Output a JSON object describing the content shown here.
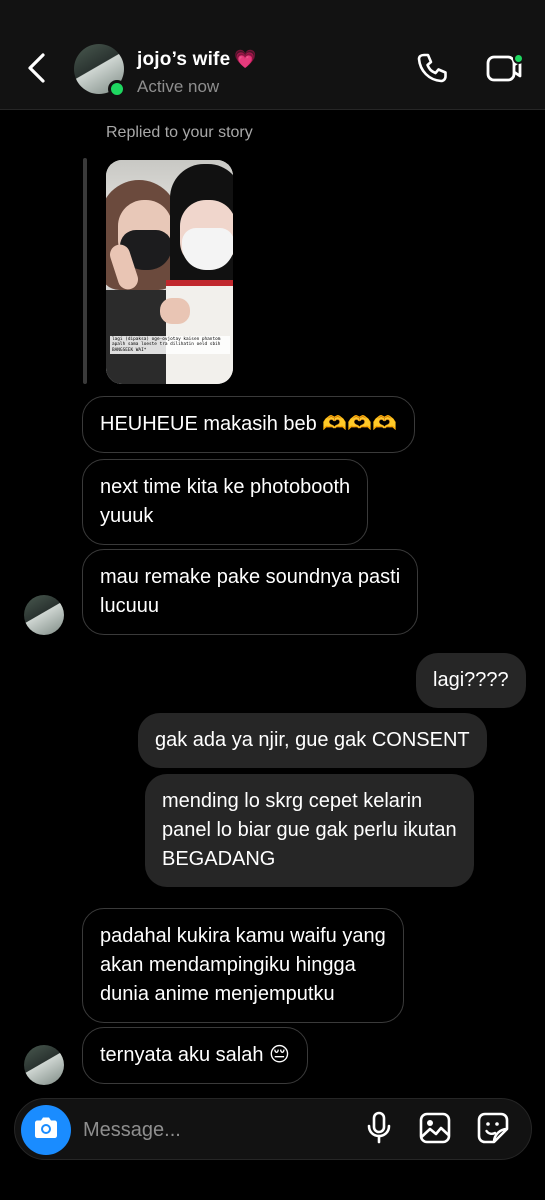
{
  "header": {
    "contact_name": "jojo’s wife",
    "name_emoji": "💗",
    "status": "Active now"
  },
  "story_reply": {
    "label": "Replied to your story",
    "story_caption": "lagi (dipaksa) oge-ovjotay kaisen phantom apalh sama loeste tra dilihatin oeld sbih BANGSEEK WAI*"
  },
  "messages": [
    {
      "side": "in",
      "text": "HEUHEUE makasih beb 🫶🫶🫶"
    },
    {
      "side": "in",
      "line1": "next time kita ke photobooth",
      "line2": "yuuuk"
    },
    {
      "side": "in",
      "line1": "mau remake pake soundnya pasti",
      "line2": "lucuuu"
    },
    {
      "side": "out",
      "text": "lagi????"
    },
    {
      "side": "out",
      "text": "gak ada ya njir, gue gak CONSENT"
    },
    {
      "side": "out",
      "line1": "mending lo skrg cepet kelarin",
      "line2": "panel lo biar gue gak perlu ikutan",
      "line3": "BEGADANG"
    },
    {
      "side": "in",
      "line1": "padahal kukira kamu waifu yang",
      "line2": "akan mendampingiku hingga",
      "line3": "dunia anime menjemputku"
    },
    {
      "side": "in",
      "text": "ternyata aku salah 😔"
    }
  ],
  "composer": {
    "placeholder": "Message..."
  },
  "icons": {
    "back": "chevron-left-icon",
    "call": "phone-icon",
    "video": "video-call-icon",
    "camera": "camera-icon",
    "mic": "microphone-icon",
    "gallery": "image-icon",
    "sticker": "sticker-icon"
  },
  "colors": {
    "accent": "#1a8cff",
    "online": "#1ed760",
    "outgoing_bubble": "#262626",
    "incoming_border": "#3a3a3a"
  }
}
